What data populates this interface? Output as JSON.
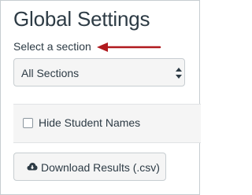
{
  "page": {
    "title": "Global Settings"
  },
  "section_select": {
    "label": "Select a section",
    "selected": "All Sections"
  },
  "options": {
    "hide_student_names_label": "Hide Student Names",
    "hide_student_names_checked": false
  },
  "actions": {
    "download_label": "Download Results (.csv)"
  },
  "colors": {
    "annotation_arrow": "#b0191e",
    "text": "#2d3b45",
    "control_bg": "#f5f5f5",
    "border": "#c7cdd1"
  },
  "icons": {
    "download": "cloud-download-icon",
    "select": "chevron-up-down-icon",
    "annotation": "arrow-left-icon"
  }
}
